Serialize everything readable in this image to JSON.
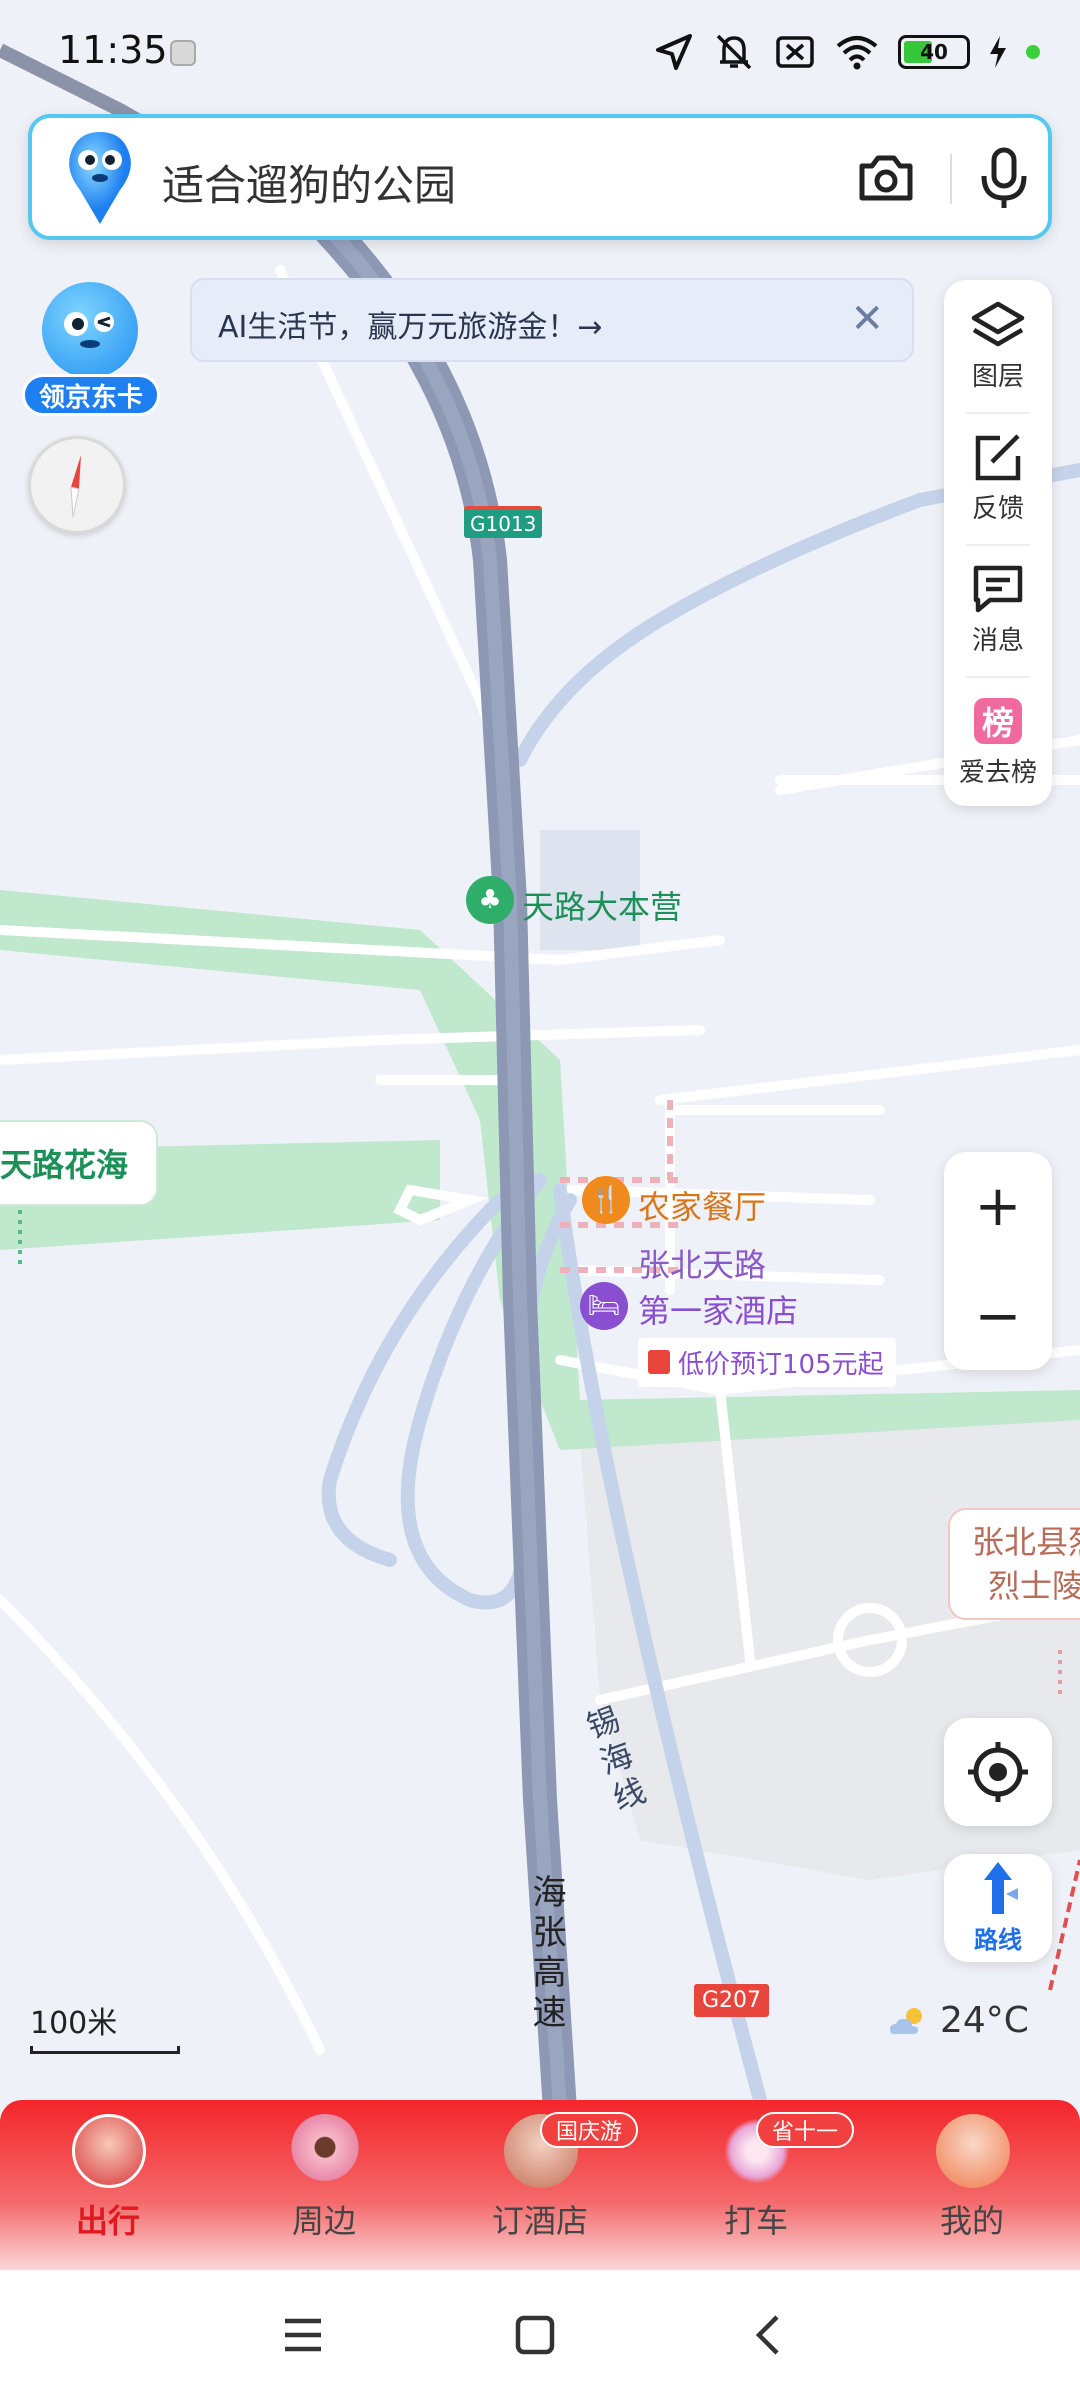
{
  "status_bar": {
    "time": "11:35",
    "battery": "40",
    "icons": [
      "location-icon",
      "mute-icon",
      "no-sim-icon",
      "wifi-icon",
      "battery-icon",
      "charging-icon"
    ]
  },
  "search": {
    "query": "适合遛狗的公园",
    "camera_icon": "camera-icon",
    "mic_icon": "microphone-icon"
  },
  "jd_card": {
    "label": "领京东卡"
  },
  "banner": {
    "text": "AI生活节，赢万元旅游金！→",
    "close": "✕"
  },
  "right_panel": {
    "items": [
      {
        "label": "图层",
        "icon": "layers-icon"
      },
      {
        "label": "反馈",
        "icon": "feedback-icon"
      },
      {
        "label": "消息",
        "icon": "message-icon"
      },
      {
        "label": "爱去榜",
        "icon": "ranking-icon"
      }
    ]
  },
  "zoom": {
    "in": "+",
    "out": "−"
  },
  "route": {
    "label": "路线"
  },
  "map": {
    "road_g1013": "G1013",
    "road_g207": "G207",
    "poi_camp": "天路大本营",
    "poi_flower_sea": "天路花海",
    "poi_restaurant": "农家餐厅",
    "road_zhangbei": "张北天路",
    "poi_hotel": "第一家酒店",
    "hotel_promo": "低价预订105元起",
    "poi_cemetery_line1": "张北县烈",
    "poi_cemetery_line2": "烈士陵",
    "road_xihai": "锡海线",
    "road_haizhang": "海张高速"
  },
  "scale": {
    "text": "100米"
  },
  "weather": {
    "temp": "24°C",
    "icon": "partly-cloudy-icon"
  },
  "tabs": [
    {
      "label": "出行",
      "active": true,
      "badge": ""
    },
    {
      "label": "周边",
      "active": false,
      "badge": ""
    },
    {
      "label": "订酒店",
      "active": false,
      "badge": "国庆游"
    },
    {
      "label": "打车",
      "active": false,
      "badge": "省十一"
    },
    {
      "label": "我的",
      "active": false,
      "badge": ""
    }
  ],
  "colors": {
    "accent_blue": "#1e7ff0",
    "tab_red": "#e0191e",
    "highway": "#8d98b4",
    "green_area": "#bfe8cc"
  }
}
